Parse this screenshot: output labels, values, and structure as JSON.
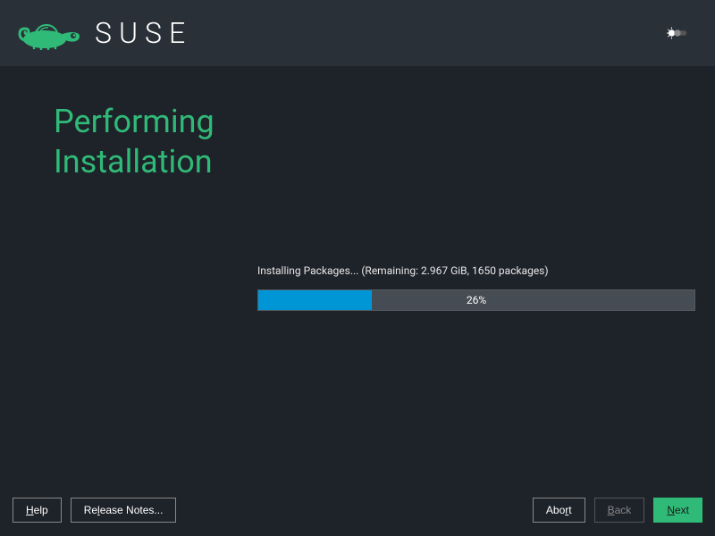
{
  "brand": {
    "name": "SUSE"
  },
  "page": {
    "title_line1": "Performing",
    "title_line2": "Installation"
  },
  "progress": {
    "status_text": "Installing Packages... (Remaining: 2.967 GiB, 1650 packages)",
    "percent_label": "26%",
    "percent_value": 26
  },
  "footer": {
    "help_label": "elp",
    "help_mnemonic": "H",
    "release_notes_label": "lease Notes...",
    "release_notes_mnemonic": "Re",
    "abort_label": "t",
    "abort_prefix": "Abo",
    "abort_mnemonic": "r",
    "back_label": "ack",
    "back_mnemonic": "B",
    "next_label": "ext",
    "next_mnemonic": "N"
  },
  "colors": {
    "accent": "#30ba78",
    "progress": "#0096d6"
  }
}
